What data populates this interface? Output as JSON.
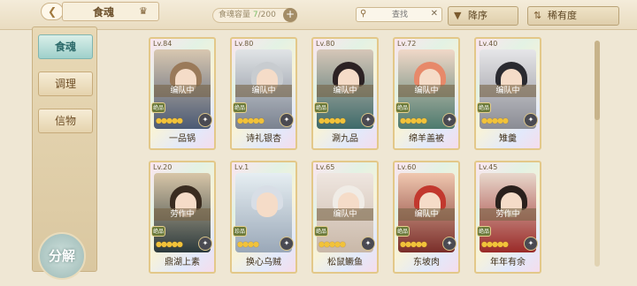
{
  "header": {
    "title": "食魂",
    "capacity_prefix": "食魂容量",
    "capacity_current": "7",
    "capacity_max": "/200",
    "search_placeholder": "查找",
    "sort_order": "降序",
    "sort_by": "稀有度"
  },
  "sidebar": {
    "tabs": [
      {
        "label": "食魂",
        "active": true
      },
      {
        "label": "调理",
        "active": false
      },
      {
        "label": "信物",
        "active": false
      }
    ],
    "decompose": "分解"
  },
  "cards": [
    {
      "level": "Lv.84",
      "status": "编队中",
      "name": "一品锅",
      "rarity": "绝品"
    },
    {
      "level": "Lv.80",
      "status": "编队中",
      "name": "诗礼银杏",
      "rarity": "绝品"
    },
    {
      "level": "Lv.80",
      "status": "编队中",
      "name": "涮九品",
      "rarity": "绝品"
    },
    {
      "level": "Lv.72",
      "status": "编队中",
      "name": "绵羊盖被",
      "rarity": "绝品"
    },
    {
      "level": "Lv.40",
      "status": "编队中",
      "name": "雉羹",
      "rarity": "绝品"
    },
    {
      "level": "Lv.20",
      "status": "劳作中",
      "name": "鼎湖上素",
      "rarity": "绝品"
    },
    {
      "level": "Lv.1",
      "status": "",
      "name": "换心乌贼",
      "rarity": "珍品"
    },
    {
      "level": "Lv.65",
      "status": "编队中",
      "name": "松鼠鳜鱼",
      "rarity": "绝品"
    },
    {
      "level": "Lv.60",
      "status": "编队中",
      "name": "东坡肉",
      "rarity": "绝品"
    },
    {
      "level": "Lv.45",
      "status": "劳作中",
      "name": "年年有余",
      "rarity": "绝品"
    }
  ]
}
